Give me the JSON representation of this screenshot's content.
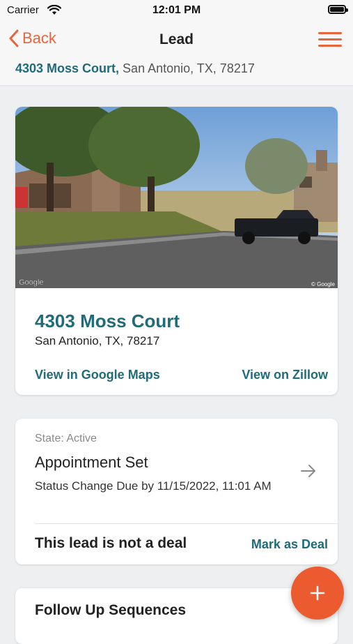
{
  "status_bar": {
    "carrier": "Carrier",
    "time": "12:01 PM"
  },
  "nav": {
    "back_label": "Back",
    "title": "Lead",
    "address_bold": "4303 Moss Court,",
    "address_rest": " San Antonio, TX, 78217"
  },
  "property_card": {
    "street": "4303 Moss Court",
    "city_state_zip": "San Antonio, TX, 78217",
    "google_maps_link": "View in Google Maps",
    "zillow_link": "View on Zillow",
    "image_watermark_left": "Google",
    "image_watermark_right": "© Google"
  },
  "status_card": {
    "state": "State: Active",
    "status": "Appointment Set",
    "due": "Status Change Due by 11/15/2022, 11:01 AM",
    "deal_text": "This lead is not a deal",
    "mark_deal": "Mark as Deal"
  },
  "follow_up_card": {
    "title": "Follow Up Sequences"
  },
  "icons": [
    "wifi-icon",
    "battery-icon",
    "back-chevron-icon",
    "menu-icon",
    "arrow-right-icon",
    "plus-icon"
  ],
  "colors": {
    "accent": "#e8653b",
    "link": "#1f6b79",
    "fab": "#ec5b2f"
  }
}
